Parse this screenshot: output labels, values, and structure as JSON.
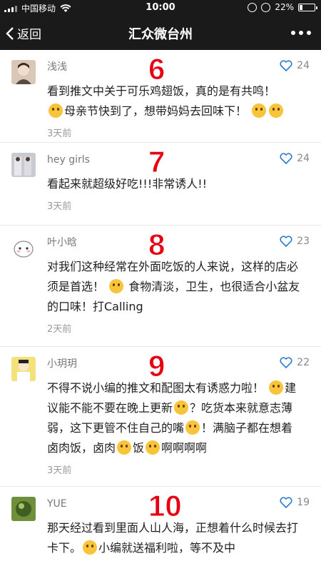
{
  "status": {
    "carrier": "中国移动",
    "time": "10:00",
    "battery": "22%",
    "battery_level": 0.22
  },
  "nav": {
    "back_label": "返回",
    "title": "汇众微台州"
  },
  "comments": [
    {
      "badge": "6",
      "name": "浅浅",
      "likes": "24",
      "time": "3天前",
      "text_parts": [
        "看到推文中关于可乐鸡翅饭，真的是有共鸣！",
        "母亲节快到了，想带妈妈去回味下！"
      ]
    },
    {
      "badge": "7",
      "name": "hey girls",
      "likes": "24",
      "time": "3天前",
      "text_parts": [
        "看起来就超级好吃!!!非常诱人!!"
      ]
    },
    {
      "badge": "8",
      "name": "叶小晗",
      "likes": "23",
      "time": "2天前",
      "text_parts": [
        "对我们这种经常在外面吃饭的人来说，这样的店必须是首选！",
        "食物清淡，卫生，也很适合小盆友的口味！打Calling"
      ]
    },
    {
      "badge": "9",
      "name": "小玥玥",
      "likes": "22",
      "time": "3天前",
      "text_parts": [
        "不得不说小编的推文和配图太有诱惑力啦！",
        "建议能不能不要在晚上更新",
        "？吃货本来就意志薄弱，这下更管不住自己的嘴",
        "！满脑子都在想着卤肉饭，卤肉",
        "饭",
        "啊啊啊啊"
      ]
    },
    {
      "badge": "10",
      "name": "YUE",
      "likes": "19",
      "time": "",
      "text_parts": [
        "那天经过看到里面人山人海，正想着什么时候去打卡下。",
        "小编就送福利啦，等不及中"
      ]
    }
  ]
}
